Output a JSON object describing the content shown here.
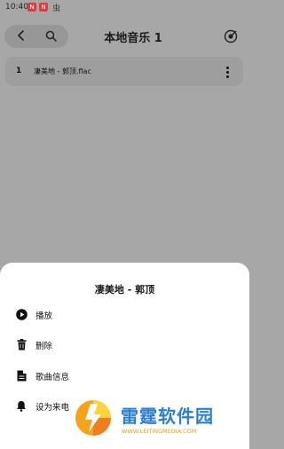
{
  "status_bar": {
    "time": "10:40",
    "icon1": "N",
    "icon2": "N",
    "bug_char": "虫"
  },
  "header": {
    "title": "本地音乐 1"
  },
  "tracks": [
    {
      "index": "1",
      "name": "凄美地 - 郭顶.flac"
    }
  ],
  "sheet": {
    "title": "凄美地 - 郭顶",
    "items": [
      {
        "label": "播放",
        "icon": "play-icon"
      },
      {
        "label": "删除",
        "icon": "trash-icon"
      },
      {
        "label": "歌曲信息",
        "icon": "document-icon"
      },
      {
        "label": "设为来电",
        "icon": "bell-icon"
      }
    ]
  },
  "watermark": {
    "title": "雷霆软件园",
    "url": "WWW.LEITINGMEDIA.COM"
  },
  "colors": {
    "overlay": "#a7a7a7",
    "sheet": "#ffffff",
    "watermark_blue": "#2c7fd0",
    "watermark_orange": "#f39b1e"
  }
}
